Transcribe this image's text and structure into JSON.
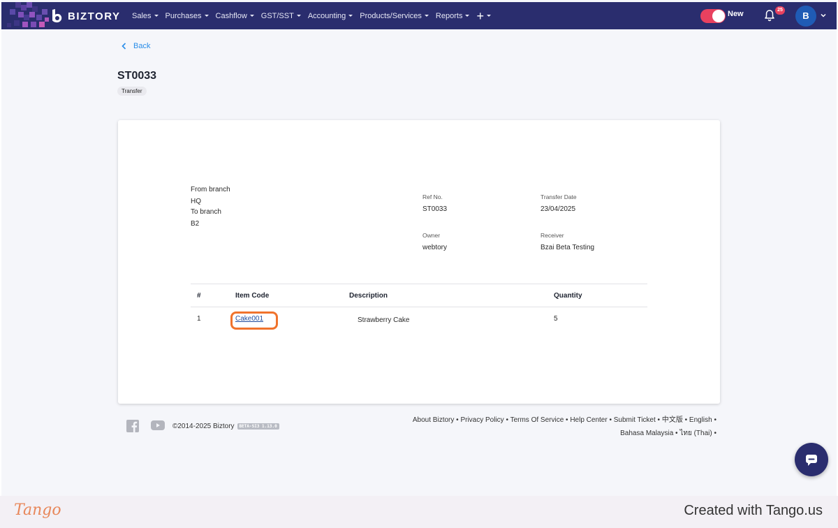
{
  "app": {
    "brand": "BIZTORY",
    "menu": [
      {
        "label": "Sales",
        "has_caret": true
      },
      {
        "label": "Purchases",
        "has_caret": true
      },
      {
        "label": "Cashflow",
        "has_caret": true
      },
      {
        "label": "GST/SST",
        "has_caret": true
      },
      {
        "label": "Accounting",
        "has_caret": true
      },
      {
        "label": "Products/Services",
        "has_caret": true
      },
      {
        "label": "Reports",
        "has_caret": true
      }
    ],
    "add_icon": "+",
    "toggle_label": "New",
    "toggle_on": true,
    "notification_count": "25",
    "avatar_initial": "B",
    "colors": {
      "navbar": "#2a2d6e",
      "accent_pink": "#e8415f",
      "link_blue": "#2a8de8",
      "highlight_orange": "#f0732d",
      "avatar_blue": "#1f5bb5"
    }
  },
  "page": {
    "back_label": "Back",
    "title": "ST0033",
    "type_tag": "Transfer"
  },
  "transfer": {
    "from_branch_label": "From branch",
    "from_branch": "HQ",
    "to_branch_label": "To branch",
    "to_branch": "B2",
    "ref_no_label": "Ref No.",
    "ref_no": "ST0033",
    "transfer_date_label": "Transfer Date",
    "transfer_date": "23/04/2025",
    "owner_label": "Owner",
    "owner": "webtory",
    "receiver_label": "Receiver",
    "receiver": "Bzai Beta Testing"
  },
  "table": {
    "headers": {
      "num": "#",
      "item_code": "Item Code",
      "description": "Description",
      "quantity": "Quantity"
    },
    "rows": [
      {
        "num": "1",
        "item_code": "Cake001",
        "description": "Strawberry Cake",
        "quantity": "5"
      }
    ]
  },
  "footer": {
    "copyright": "©2014-2025 Biztory",
    "version": "BETA-SI3 1.13.0",
    "links_line1": [
      "About Biztory",
      "Privacy Policy",
      "Terms Of Service",
      "Help Center",
      "Submit Ticket",
      "中文版",
      "English"
    ],
    "links_line2": [
      "Bahasa Malaysia",
      "ไทย (Thai)"
    ],
    "icons": [
      "facebook-icon",
      "youtube-icon"
    ]
  },
  "tango": {
    "logo": "Tango",
    "credit": "Created with Tango.us"
  }
}
